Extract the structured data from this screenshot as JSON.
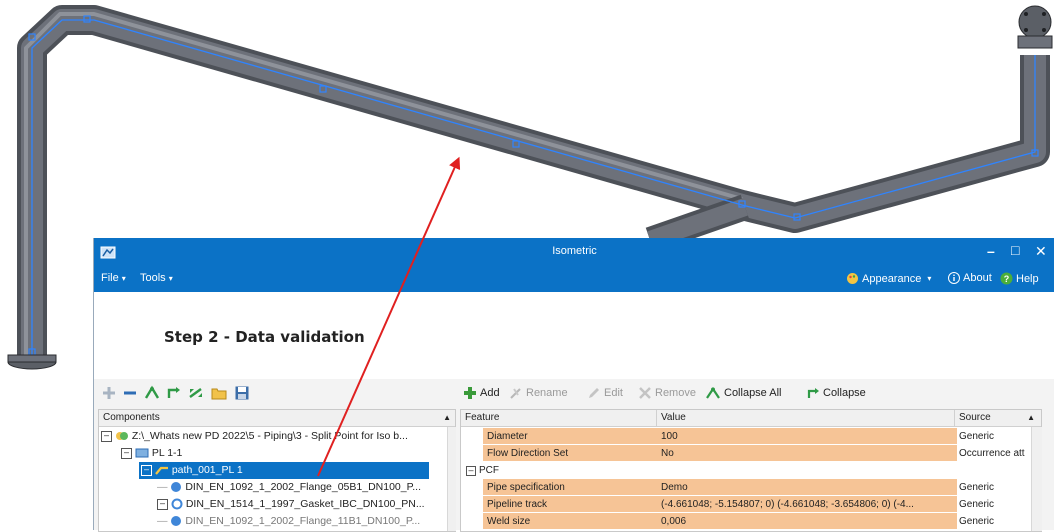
{
  "window": {
    "title": "Isometric",
    "minimize_glyph": "–",
    "maximize_glyph": "□",
    "close_glyph": "✕"
  },
  "menubar": {
    "file": "File",
    "tools": "Tools",
    "appearance": "Appearance",
    "about": "About",
    "help": "Help"
  },
  "step_title": "Step 2 - Data validation",
  "left_panel": {
    "header": "Components",
    "tree": [
      {
        "label": "Z:\\_Whats new PD 2022\\5 - Piping\\3 - Split Point for Iso b...",
        "icon": "assembly-icon"
      },
      {
        "label": "PL 1-1",
        "icon": "pipeline-icon"
      },
      {
        "label": "path_001_PL 1",
        "icon": "path-icon",
        "selected": true
      },
      {
        "label": "DIN_EN_1092_1_2002_Flange_05B1_DN100_P...",
        "icon": "flange-icon"
      },
      {
        "label": "DIN_EN_1514_1_1997_Gasket_IBC_DN100_PN...",
        "icon": "gasket-icon"
      },
      {
        "label": "DIN_EN_1092_1_2002_Flange_11B1_DN100_P...",
        "icon": "flange-icon"
      }
    ]
  },
  "right_panel": {
    "toolbar": {
      "add": "Add",
      "rename": "Rename",
      "edit": "Edit",
      "remove": "Remove",
      "collapse_all": "Collapse All",
      "collapse": "Collapse"
    },
    "columns": {
      "feature": "Feature",
      "value": "Value",
      "source": "Source"
    },
    "rows": [
      {
        "feature": "Diameter",
        "value": "100",
        "source": "Generic",
        "highlight": true
      },
      {
        "feature": "Flow Direction Set",
        "value": "No",
        "source": "Occurrence att",
        "highlight": true
      },
      {
        "feature": "PCF",
        "value": "",
        "source": "",
        "group": true
      },
      {
        "feature": "Pipe specification",
        "value": "Demo",
        "source": "Generic",
        "highlight": true
      },
      {
        "feature": "Pipeline track",
        "value": "(-4.661048; -5.154807; 0)  (-4.661048; -3.654806; 0)  (-4...",
        "source": "Generic",
        "highlight": true
      },
      {
        "feature": "Weld size",
        "value": "0,006",
        "source": "Generic",
        "highlight": true
      }
    ]
  },
  "colors": {
    "titlebar": "#0b72c6",
    "highlight_row": "#f6c496",
    "selected_row": "#0b72c6",
    "annotation_arrow": "#e02020",
    "pipe_edge": "#2f84ff"
  }
}
